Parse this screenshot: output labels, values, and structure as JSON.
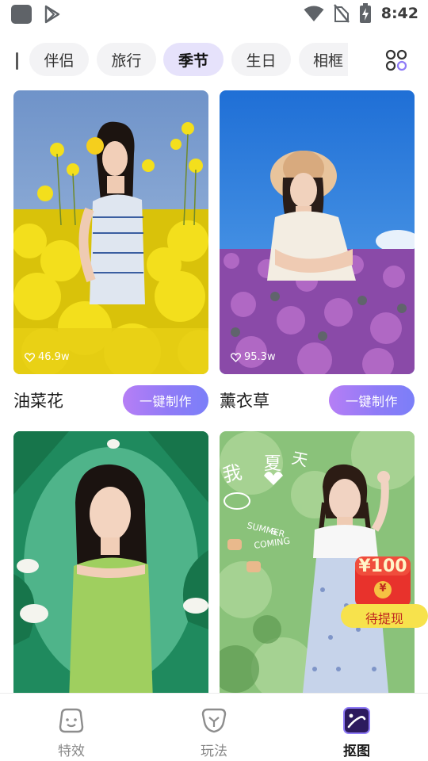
{
  "status_bar": {
    "time": "8:42"
  },
  "tabs": [
    "伴侣",
    "旅行",
    "季节",
    "生日",
    "相框"
  ],
  "active_tab": "季节",
  "cards": [
    {
      "title": "油菜花",
      "likes": "46.9w",
      "button": "一键制作"
    },
    {
      "title": "薰衣草",
      "likes": "95.3w",
      "button": "一键制作"
    },
    {
      "title": ""
    },
    {
      "title": ""
    }
  ],
  "card4_overlay_text": [
    "我",
    "夏",
    "天",
    "SUMMER",
    "&",
    "COMING"
  ],
  "red_packet": {
    "amount": "¥100",
    "coin": "¥",
    "label": "待提现"
  },
  "bottom_nav": {
    "items": [
      {
        "label": "特效",
        "icon": "face-icon"
      },
      {
        "label": "玩法",
        "icon": "cup-icon"
      },
      {
        "label": "抠图",
        "icon": "cutout-icon"
      }
    ],
    "active": "抠图"
  },
  "colors": {
    "accent": "#8f7bf7",
    "tab_active_bg": "#e6e2fb",
    "red_packet": "#e8322c"
  }
}
